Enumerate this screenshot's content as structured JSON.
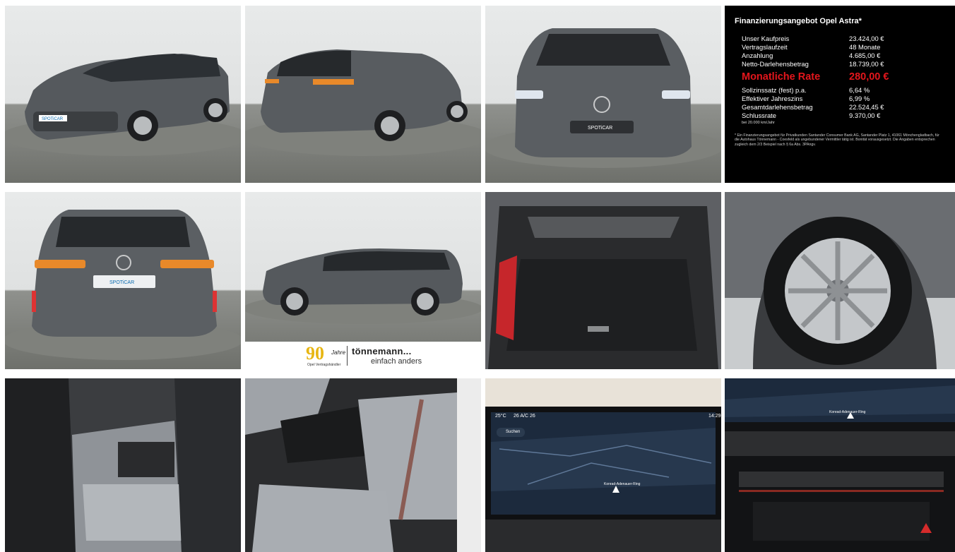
{
  "financing": {
    "title": "Finanzierungsangebot Opel Astra*",
    "rows_top": [
      {
        "label": "Unser Kaufpreis",
        "value": "23.424,00 €"
      },
      {
        "label": "Vertragslaufzeit",
        "value": "48 Monate"
      },
      {
        "label": "Anzahlung",
        "value": "4.685,00 €"
      },
      {
        "label": "Netto-Darlehensbetrag",
        "value": "18.739,00 €"
      }
    ],
    "rate": {
      "label": "Monatliche Rate",
      "value": "280,00 €"
    },
    "rows_bottom": [
      {
        "label": "Sollzinssatz (fest) p.a.",
        "value": "6,64 %"
      },
      {
        "label": "Effektiver Jahreszins",
        "value": "6,99 %"
      },
      {
        "label": "Gesamtdarlehensbetrag",
        "value": "22.524,45 €"
      },
      {
        "label": "Schlussrate",
        "value": "9.370,00 €"
      }
    ],
    "mileage": "bei 20.000 km/Jahr",
    "footnote": "* Ein Finanzierungsangebot für Privatkunden Santander Consumer Bank AG, Santander Platz 1, 41061 Mönchengladbach, für die Autohaus Tönnemann - Coesfeld als ungebundener Vermittler tätig ist. Bonität vorausgesetzt. Die Angaben entsprechen zugleich dem 2/3 Beispiel nach § 6a Abs. 3PAngv."
  },
  "dealer_logo": {
    "number": "90",
    "jahre": "Jahre",
    "sub": "Opel Vertragshändler",
    "brand": "tönnemann...",
    "slogan": "einfach anders"
  },
  "plate_text": "SPOTiCAR",
  "nav_screen": {
    "temp": "25°C",
    "status": "26 A/C 26",
    "time": "14:29",
    "search_label": "Suchen",
    "street": "Konrad-Adenauer-Ring"
  },
  "nav_screen_2": {
    "street": "Konrad-Adenauer-Ring"
  },
  "colors": {
    "car_grey": "#5b5f63",
    "rate_red": "#e3161c",
    "logo_gold": "#e7b614"
  }
}
